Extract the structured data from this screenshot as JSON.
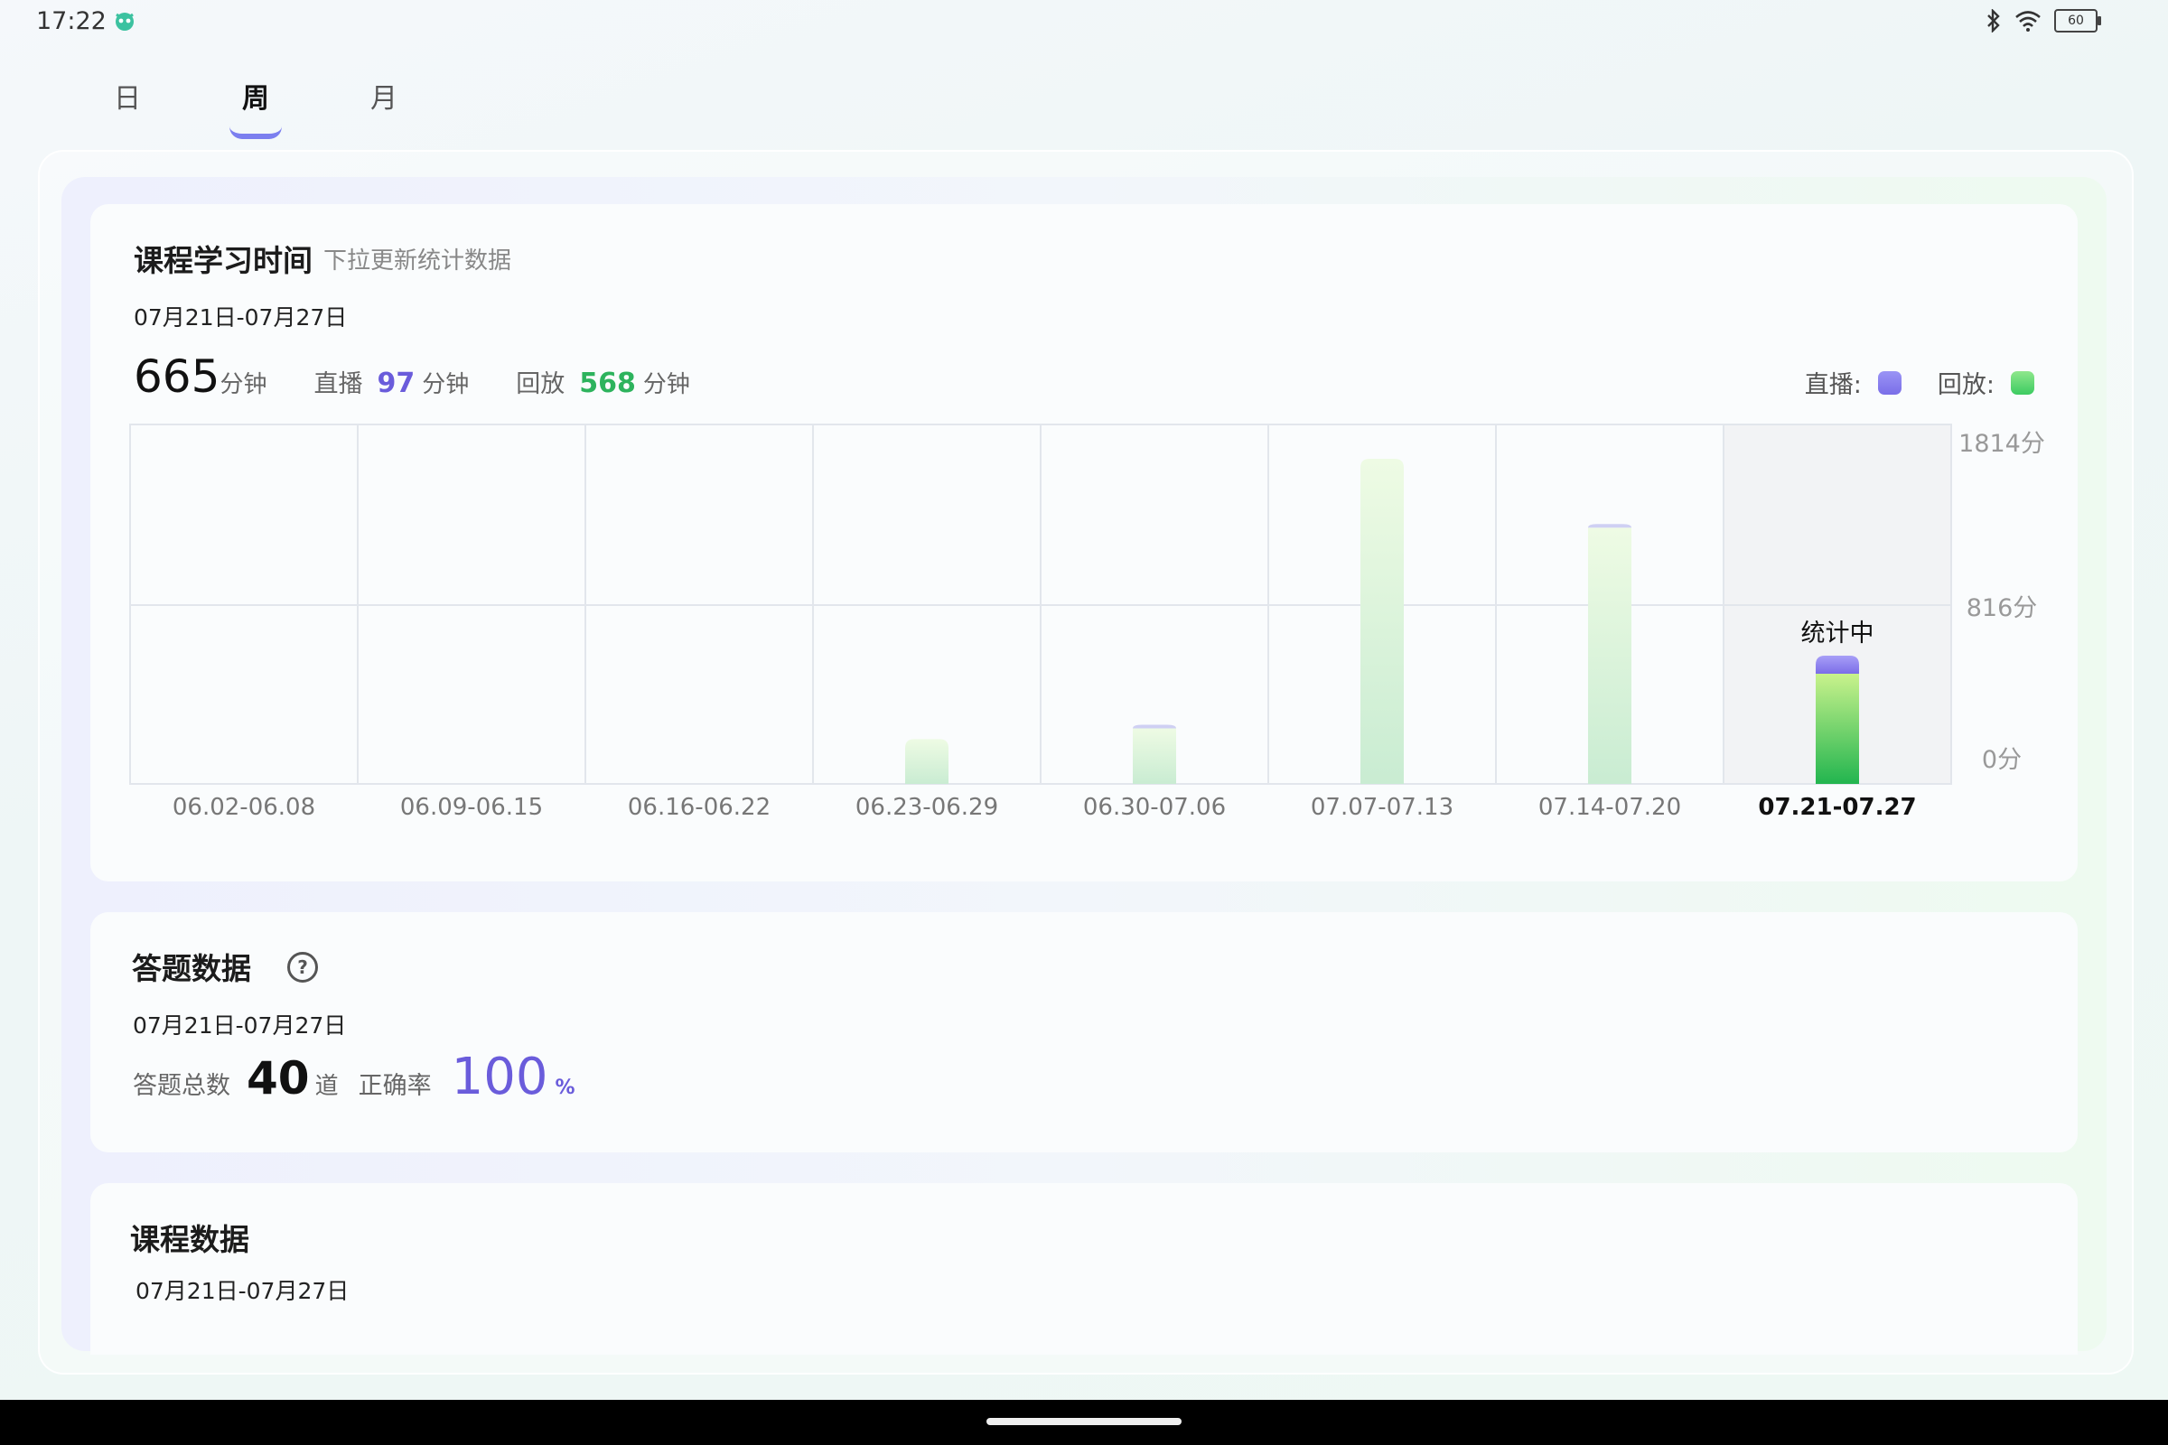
{
  "status_bar": {
    "time": "17:22",
    "battery": "60"
  },
  "tabs": [
    {
      "label": "日",
      "active": false
    },
    {
      "label": "周",
      "active": true
    },
    {
      "label": "月",
      "active": false
    }
  ],
  "study_time": {
    "title": "课程学习时间",
    "subtitle": "下拉更新统计数据",
    "date_range": "07月21日-07月27日",
    "total_value": "665",
    "total_unit": "分钟",
    "live_label": "直播",
    "live_value": "97",
    "live_unit": "分钟",
    "replay_label": "回放",
    "replay_value": "568",
    "replay_unit": "分钟",
    "legend_live": "直播:",
    "legend_replay": "回放:",
    "counting_label": "统计中"
  },
  "chart_data": {
    "type": "bar",
    "stacked": true,
    "categories": [
      "06.02-06.08",
      "06.09-06.15",
      "06.16-06.22",
      "06.23-06.29",
      "06.30-07.06",
      "07.07-07.13",
      "07.14-07.20",
      "07.21-07.27"
    ],
    "series": [
      {
        "name": "直播",
        "values": [
          0,
          0,
          0,
          0,
          20,
          0,
          15,
          97
        ]
      },
      {
        "name": "回放",
        "values": [
          0,
          0,
          0,
          250,
          310,
          1814,
          1430,
          568
        ]
      }
    ],
    "y_ticks": [
      "0分",
      "816分",
      "1814分"
    ],
    "highlight_category": "07.21-07.27",
    "colors": {
      "live": "#7d72ea",
      "replay": "#3ccb61",
      "replay_light": "#d8f3dc"
    }
  },
  "answers": {
    "title": "答题数据",
    "date_range": "07月21日-07月27日",
    "total_label": "答题总数",
    "total_value": "40",
    "total_unit": "道",
    "accuracy_label": "正确率",
    "accuracy_value": "100",
    "accuracy_unit": "%"
  },
  "course_data": {
    "title": "课程数据",
    "date_range": "07月21日-07月27日"
  }
}
